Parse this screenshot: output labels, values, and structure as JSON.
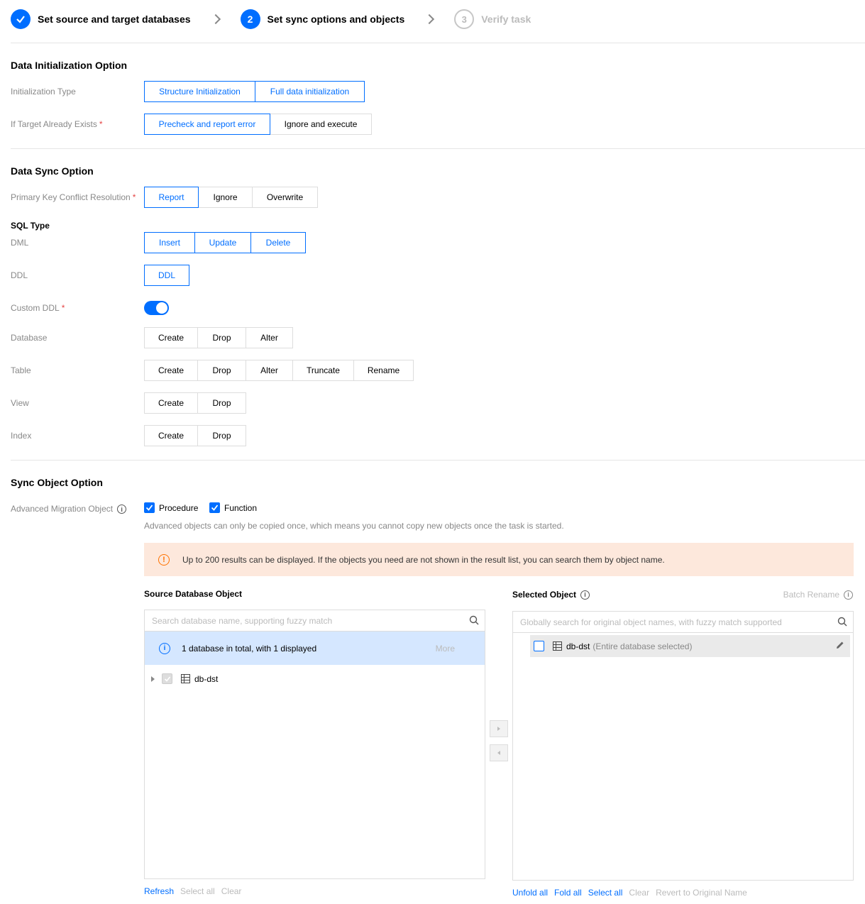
{
  "steps": [
    {
      "label": "Set source and target databases",
      "state": "done",
      "icon": "check-icon"
    },
    {
      "number": "2",
      "label": "Set sync options and objects",
      "state": "active"
    },
    {
      "number": "3",
      "label": "Verify task",
      "state": "todo"
    }
  ],
  "data_init": {
    "title": "Data Initialization Option",
    "init_type_label": "Initialization Type",
    "init_type_options": [
      "Structure Initialization",
      "Full data initialization"
    ],
    "target_exists_label": "If Target Already Exists",
    "target_exists_options": [
      "Precheck and report error",
      "Ignore and execute"
    ],
    "target_exists_selected": "Precheck and report error",
    "required_mark": "*"
  },
  "data_sync": {
    "title": "Data Sync Option",
    "pk_label": "Primary Key Conflict Resolution",
    "pk_options": [
      "Report",
      "Ignore",
      "Overwrite"
    ],
    "pk_selected": "Report",
    "sql_type_title": "SQL Type",
    "dml_label": "DML",
    "dml_options": [
      "Insert",
      "Update",
      "Delete"
    ],
    "ddl_label": "DDL",
    "ddl_options": [
      "DDL"
    ],
    "custom_ddl_label": "Custom DDL",
    "custom_ddl_enabled": true,
    "database_label": "Database",
    "database_options": [
      "Create",
      "Drop",
      "Alter"
    ],
    "table_label": "Table",
    "table_options": [
      "Create",
      "Drop",
      "Alter",
      "Truncate",
      "Rename"
    ],
    "view_label": "View",
    "view_options": [
      "Create",
      "Drop"
    ],
    "index_label": "Index",
    "index_options": [
      "Create",
      "Drop"
    ]
  },
  "sync_object": {
    "title": "Sync Object Option",
    "adv_label": "Advanced Migration Object",
    "adv_options": [
      "Procedure",
      "Function"
    ],
    "adv_hint": "Advanced objects can only be copied once, which means you cannot copy new objects once the task is started.",
    "warning": "Up to 200 results can be displayed. If the objects you need are not shown in the result list, you can search them by object name."
  },
  "source_panel": {
    "title": "Source Database Object",
    "search_placeholder": "Search database name, supporting fuzzy match",
    "info": "1 database in total, with 1 displayed",
    "more": "More",
    "tree_items": [
      "db-dst"
    ],
    "links": [
      "Refresh",
      "Select all",
      "Clear"
    ]
  },
  "selected_panel": {
    "title": "Selected Object",
    "batch_rename": "Batch Rename",
    "search_placeholder": "Globally search for original object names, with fuzzy match supported",
    "item_name": "db-dst",
    "item_note": "(Entire database selected)",
    "links": [
      "Unfold all",
      "Fold all",
      "Select all",
      "Clear",
      "Revert to Original Name"
    ]
  },
  "colors": {
    "accent": "#006eff",
    "warning_bg": "#fde8dc",
    "warning_icon": "#ff7200",
    "info_bg": "#d5e7ff"
  }
}
